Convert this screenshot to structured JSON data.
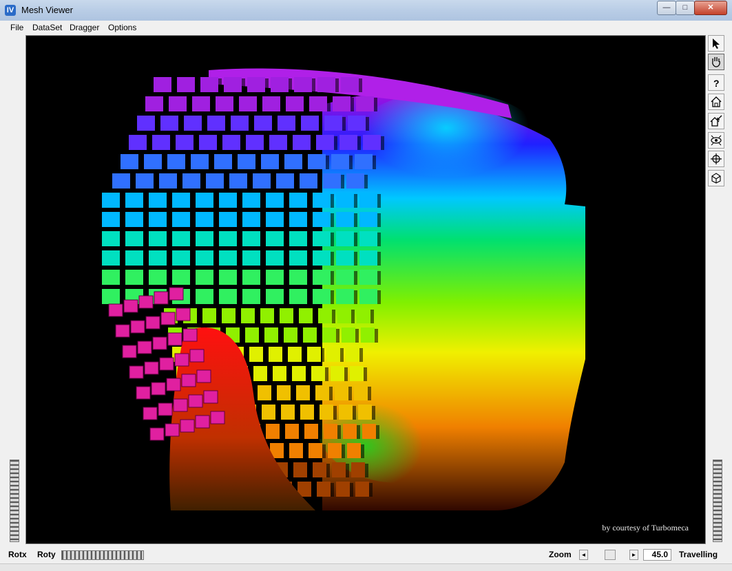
{
  "window": {
    "title": "Mesh Viewer",
    "icon": "iv-app-icon",
    "icon_text": "IV",
    "minimize": "0",
    "maximize": "1",
    "close": "r"
  },
  "menu": [
    "File",
    "DataSet",
    "Dragger",
    "Options"
  ],
  "viewport": {
    "background": "#000000",
    "courtesy_text": "by courtesy of Turbomeca"
  },
  "toolbar": {
    "buttons": [
      {
        "name": "select-arrow-icon"
      },
      {
        "name": "view-hand-icon",
        "pressed": true
      },
      {
        "name": "help-question-icon"
      },
      {
        "name": "home-icon"
      },
      {
        "name": "set-home-icon"
      },
      {
        "name": "view-all-eye-icon"
      },
      {
        "name": "seek-crosshair-icon"
      },
      {
        "name": "projection-cube-icon"
      }
    ]
  },
  "bottom": {
    "rotx_label": "Rotx",
    "roty_label": "Roty",
    "zoom_label": "Zoom",
    "zoom_left": "◄",
    "zoom_right": "►",
    "zoom_value": "45.0",
    "dolly_label": "Travelling"
  }
}
